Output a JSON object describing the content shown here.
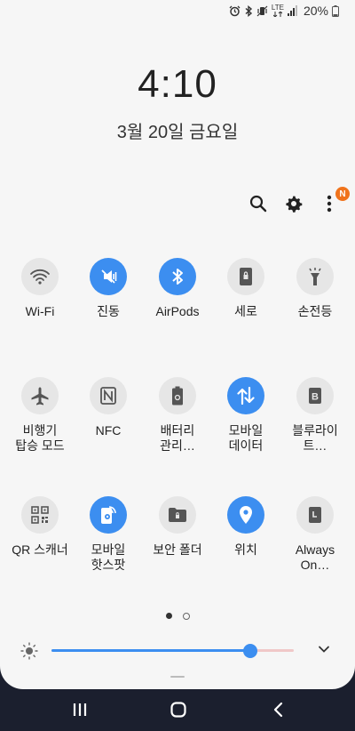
{
  "status_bar": {
    "icons": [
      "alarm-icon",
      "bluetooth-icon",
      "vibrate-icon",
      "lte-icon",
      "signal-icon",
      "battery-icon"
    ],
    "lte_label": "LTE",
    "battery_percent": "20%"
  },
  "lock": {
    "time": "4:10",
    "date": "3월 20일 금요일"
  },
  "header_actions": {
    "notification_badge": "N"
  },
  "tiles": [
    {
      "label": "Wi-Fi",
      "icon": "wifi-icon",
      "on": false
    },
    {
      "label": "진동",
      "icon": "vibrate-icon",
      "on": true
    },
    {
      "label": "AirPods",
      "icon": "bluetooth-icon",
      "on": true
    },
    {
      "label": "세로",
      "icon": "portrait-lock-icon",
      "on": false
    },
    {
      "label": "손전등",
      "icon": "flashlight-icon",
      "on": false
    },
    {
      "label": "비행기\n탑승 모드",
      "icon": "airplane-icon",
      "on": false
    },
    {
      "label": "NFC",
      "icon": "nfc-icon",
      "on": false
    },
    {
      "label": "배터리\n관리…",
      "icon": "battery-saver-icon",
      "on": false
    },
    {
      "label": "모바일\n데이터",
      "icon": "mobile-data-icon",
      "on": true
    },
    {
      "label": "블루라이\n트…",
      "icon": "blue-light-filter-icon",
      "on": false
    },
    {
      "label": "QR 스캐너",
      "icon": "qr-code-icon",
      "on": false
    },
    {
      "label": "모바일\n핫스팟",
      "icon": "hotspot-icon",
      "on": true
    },
    {
      "label": "보안 폴더",
      "icon": "secure-folder-icon",
      "on": false
    },
    {
      "label": "위치",
      "icon": "location-icon",
      "on": true
    },
    {
      "label": "Always\nOn…",
      "icon": "always-on-display-icon",
      "on": false
    }
  ],
  "pagination": {
    "current": 1,
    "total": 2
  },
  "brightness": {
    "level": 0.82
  },
  "colors": {
    "accent": "#3c8ef0",
    "badge": "#f0731c",
    "panel": "#f6f6f6",
    "navbar": "#1b1f2e"
  },
  "navigation": [
    "recent-apps-icon",
    "home-icon",
    "back-icon"
  ]
}
